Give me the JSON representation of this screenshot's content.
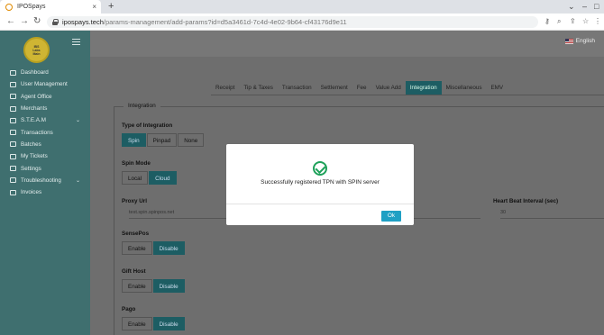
{
  "browser": {
    "tab_title": "IPOSpays",
    "url_host": "ipospays.tech",
    "url_path": "/params-management/add-params?id=d5a3461d-7c4d-4e02-9b64-cf43176d9e11"
  },
  "sidebar": {
    "logo_lines": [
      "IBS",
      "Labs",
      "Main"
    ],
    "items": [
      {
        "label": "Dashboard"
      },
      {
        "label": "User Management"
      },
      {
        "label": "Agent Office"
      },
      {
        "label": "Merchants"
      },
      {
        "label": "S.T.E.A.M"
      },
      {
        "label": "Transactions"
      },
      {
        "label": "Batches"
      },
      {
        "label": "My Tickets"
      },
      {
        "label": "Settings"
      },
      {
        "label": "Troubleshooting"
      },
      {
        "label": "Invoices"
      }
    ]
  },
  "header": {
    "language": "English"
  },
  "tabs": [
    "Receipt",
    "Tip & Taxes",
    "Transaction",
    "Settlement",
    "Fee",
    "Value Add",
    "Integration",
    "Miscellaneous",
    "EMV"
  ],
  "active_tab": "Integration",
  "form": {
    "legend": "Integration",
    "type_label": "Type of Integration",
    "type_options": [
      "Spin",
      "Pinpad",
      "None"
    ],
    "spin_mode_label": "Spin Mode",
    "spin_mode_options": [
      "Local",
      "Cloud"
    ],
    "proxy_label": "Proxy Url",
    "proxy_value": "test.spin.spinpos.net",
    "heartbeat_label": "Heart Beat Interval (sec)",
    "heartbeat_value": "30",
    "sensepos_label": "SensePos",
    "gifthost_label": "Gift Host",
    "pago_label": "Pago",
    "enable": "Enable",
    "disable": "Disable"
  },
  "modal": {
    "message": "Successfully registered TPN with SPIN server",
    "ok": "Ok"
  },
  "colors": {
    "accent": "#1d5d63",
    "sidebar": "#3f6f6f",
    "success": "#1ea15a",
    "ok_button": "#1fa0c4"
  }
}
